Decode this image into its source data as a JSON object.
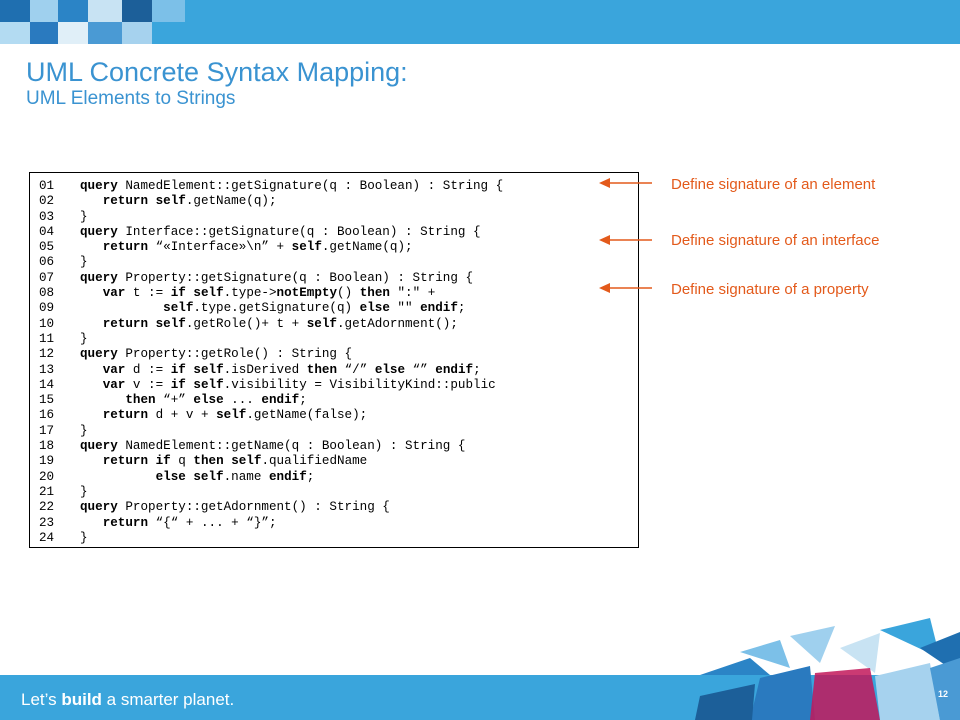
{
  "header": {
    "title": "UML Concrete Syntax Mapping:",
    "subtitle": "UML Elements to Strings"
  },
  "code_lines": [
    {
      "num": "01",
      "html": "<b>query</b> NamedElement::getSignature(q : Boolean) : String {"
    },
    {
      "num": "02",
      "html": "   <b>return self</b>.getName(q);"
    },
    {
      "num": "03",
      "html": "}"
    },
    {
      "num": "04",
      "html": "<b>query</b> Interface::getSignature(q : Boolean) : String {"
    },
    {
      "num": "05",
      "html": "   <b>return</b> “«Interface»\\n” + <b>self</b>.getName(q);"
    },
    {
      "num": "06",
      "html": "}"
    },
    {
      "num": "07",
      "html": "<b>query</b> Property::getSignature(q : Boolean) : String {"
    },
    {
      "num": "08",
      "html": "   <b>var</b> t := <b>if self</b>.type-><b>notEmpty</b>() <b>then</b> \":\" +"
    },
    {
      "num": "09",
      "html": "           <b>self</b>.type.getSignature(q) <b>else</b> \"\" <b>endif</b>;"
    },
    {
      "num": "10",
      "html": "   <b>return self</b>.getRole()+ t + <b>self</b>.getAdornment();"
    },
    {
      "num": "11",
      "html": "}"
    },
    {
      "num": "12",
      "html": "<b>query</b> Property::getRole() : String {"
    },
    {
      "num": "13",
      "html": "   <b>var</b> d := <b>if self</b>.isDerived <b>then</b> “/” <b>else</b> “” <b>endif</b>;"
    },
    {
      "num": "14",
      "html": "   <b>var</b> v := <b>if self</b>.visibility = VisibilityKind::public"
    },
    {
      "num": "15",
      "html": "      <b>then</b> “+” <b>else</b> ... <b>endif</b>;"
    },
    {
      "num": "16",
      "html": "   <b>return</b> d + v + <b>self</b>.getName(false);"
    },
    {
      "num": "17",
      "html": "}"
    },
    {
      "num": "18",
      "html": "<b>query</b> NamedElement::getName(q : Boolean) : String {"
    },
    {
      "num": "19",
      "html": "   <b>return if</b> q <b>then self</b>.qualifiedName"
    },
    {
      "num": "20",
      "html": "          <b>else self</b>.name <b>endif</b>;"
    },
    {
      "num": "21",
      "html": "}"
    },
    {
      "num": "22",
      "html": "<b>query</b> Property::getAdornment() : String {"
    },
    {
      "num": "23",
      "html": "   <b>return</b> “{“ + ... + “}”;"
    },
    {
      "num": "24",
      "html": "}"
    }
  ],
  "annotations": [
    "Define  signature of an element",
    "Define  signature of an interface",
    "Define  signature of a property"
  ],
  "footer": {
    "slogan_pre": "Let’s ",
    "slogan_bold": "build",
    "slogan_post": " a smarter planet.",
    "page_number": "12"
  },
  "colors": {
    "accent_blue": "#3aa5dc",
    "title_blue": "#3a93d1",
    "annotation_orange": "#e35a1b"
  }
}
